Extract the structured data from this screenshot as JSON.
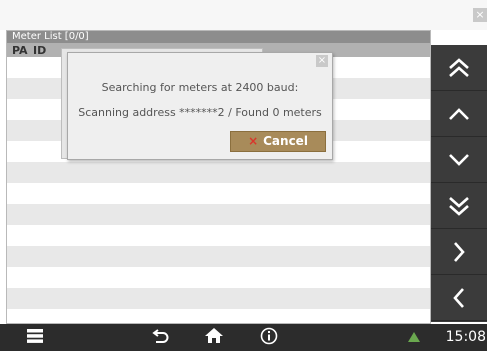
{
  "window": {
    "close_glyph": "×"
  },
  "meter_list": {
    "title": "Meter List [0/0]",
    "columns": [
      "PA",
      "ID"
    ],
    "row_count": 14
  },
  "dialog": {
    "line1": "Searching for meters at 2400 baud:",
    "line2": "Scanning address *******2 / Found 0 meters",
    "close_glyph": "×",
    "cancel_label": "Cancel",
    "cancel_icon": "×"
  },
  "side_buttons": [
    {
      "icon": "double-chevron-up-icon"
    },
    {
      "icon": "chevron-up-icon"
    },
    {
      "icon": "chevron-down-icon"
    },
    {
      "icon": "double-chevron-down-icon"
    },
    {
      "icon": "chevron-right-icon"
    },
    {
      "icon": "chevron-left-icon"
    }
  ],
  "bottom_bar": {
    "icons": [
      "menu-icon",
      "back-icon",
      "home-icon",
      "info-icon",
      "warning-icon"
    ],
    "time": "15:08",
    "warning_color": "#6aa84f"
  },
  "colors": {
    "accent_button": "#a88b5a",
    "cancel_icon": "#d9362b",
    "side_panel": "#3b3b3b",
    "bottom_bar": "#2c2c2c"
  }
}
